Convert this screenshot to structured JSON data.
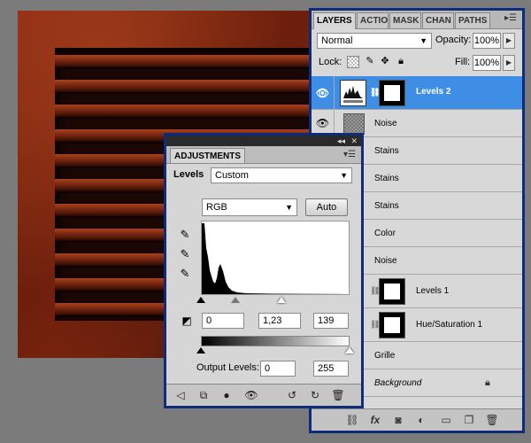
{
  "layers_panel": {
    "tabs": [
      "LAYERS",
      "ACTIO",
      "MASK",
      "CHAN",
      "PATHS"
    ],
    "blend_mode": "Normal",
    "opacity_label": "Opacity:",
    "opacity_value": "100%",
    "lock_label": "Lock:",
    "fill_label": "Fill:",
    "fill_value": "100%",
    "layers": [
      {
        "name": "Levels 2",
        "visible": true,
        "selected": true,
        "type": "adjustment"
      },
      {
        "name": "Noise",
        "visible": true,
        "type": "pixel"
      },
      {
        "name": "Stains",
        "type": "pixel"
      },
      {
        "name": "Stains",
        "type": "pixel"
      },
      {
        "name": "Stains",
        "type": "pixel"
      },
      {
        "name": "Color",
        "type": "pixel"
      },
      {
        "name": "Noise",
        "type": "pixel"
      },
      {
        "name": "Levels 1",
        "type": "adjustment"
      },
      {
        "name": "Hue/Saturation 1",
        "type": "adjustment"
      },
      {
        "name": "Grille",
        "type": "pixel"
      },
      {
        "name": "Background",
        "type": "background",
        "locked": true
      }
    ],
    "bottom_icons": [
      "link-icon",
      "fx-icon",
      "mask-icon",
      "adjustment-icon",
      "group-icon",
      "new-layer-icon",
      "trash-icon"
    ]
  },
  "adjustments_panel": {
    "tab": "ADJUSTMENTS",
    "levels_label": "Levels",
    "preset": "Custom",
    "channel": "RGB",
    "auto_label": "Auto",
    "input_black": "0",
    "input_gamma": "1,23",
    "input_white": "139",
    "output_label": "Output Levels:",
    "output_black": "0",
    "output_white": "255",
    "colors": {
      "panel_border": "#0f2c7a",
      "selected_layer": "#3d8ee4"
    }
  }
}
